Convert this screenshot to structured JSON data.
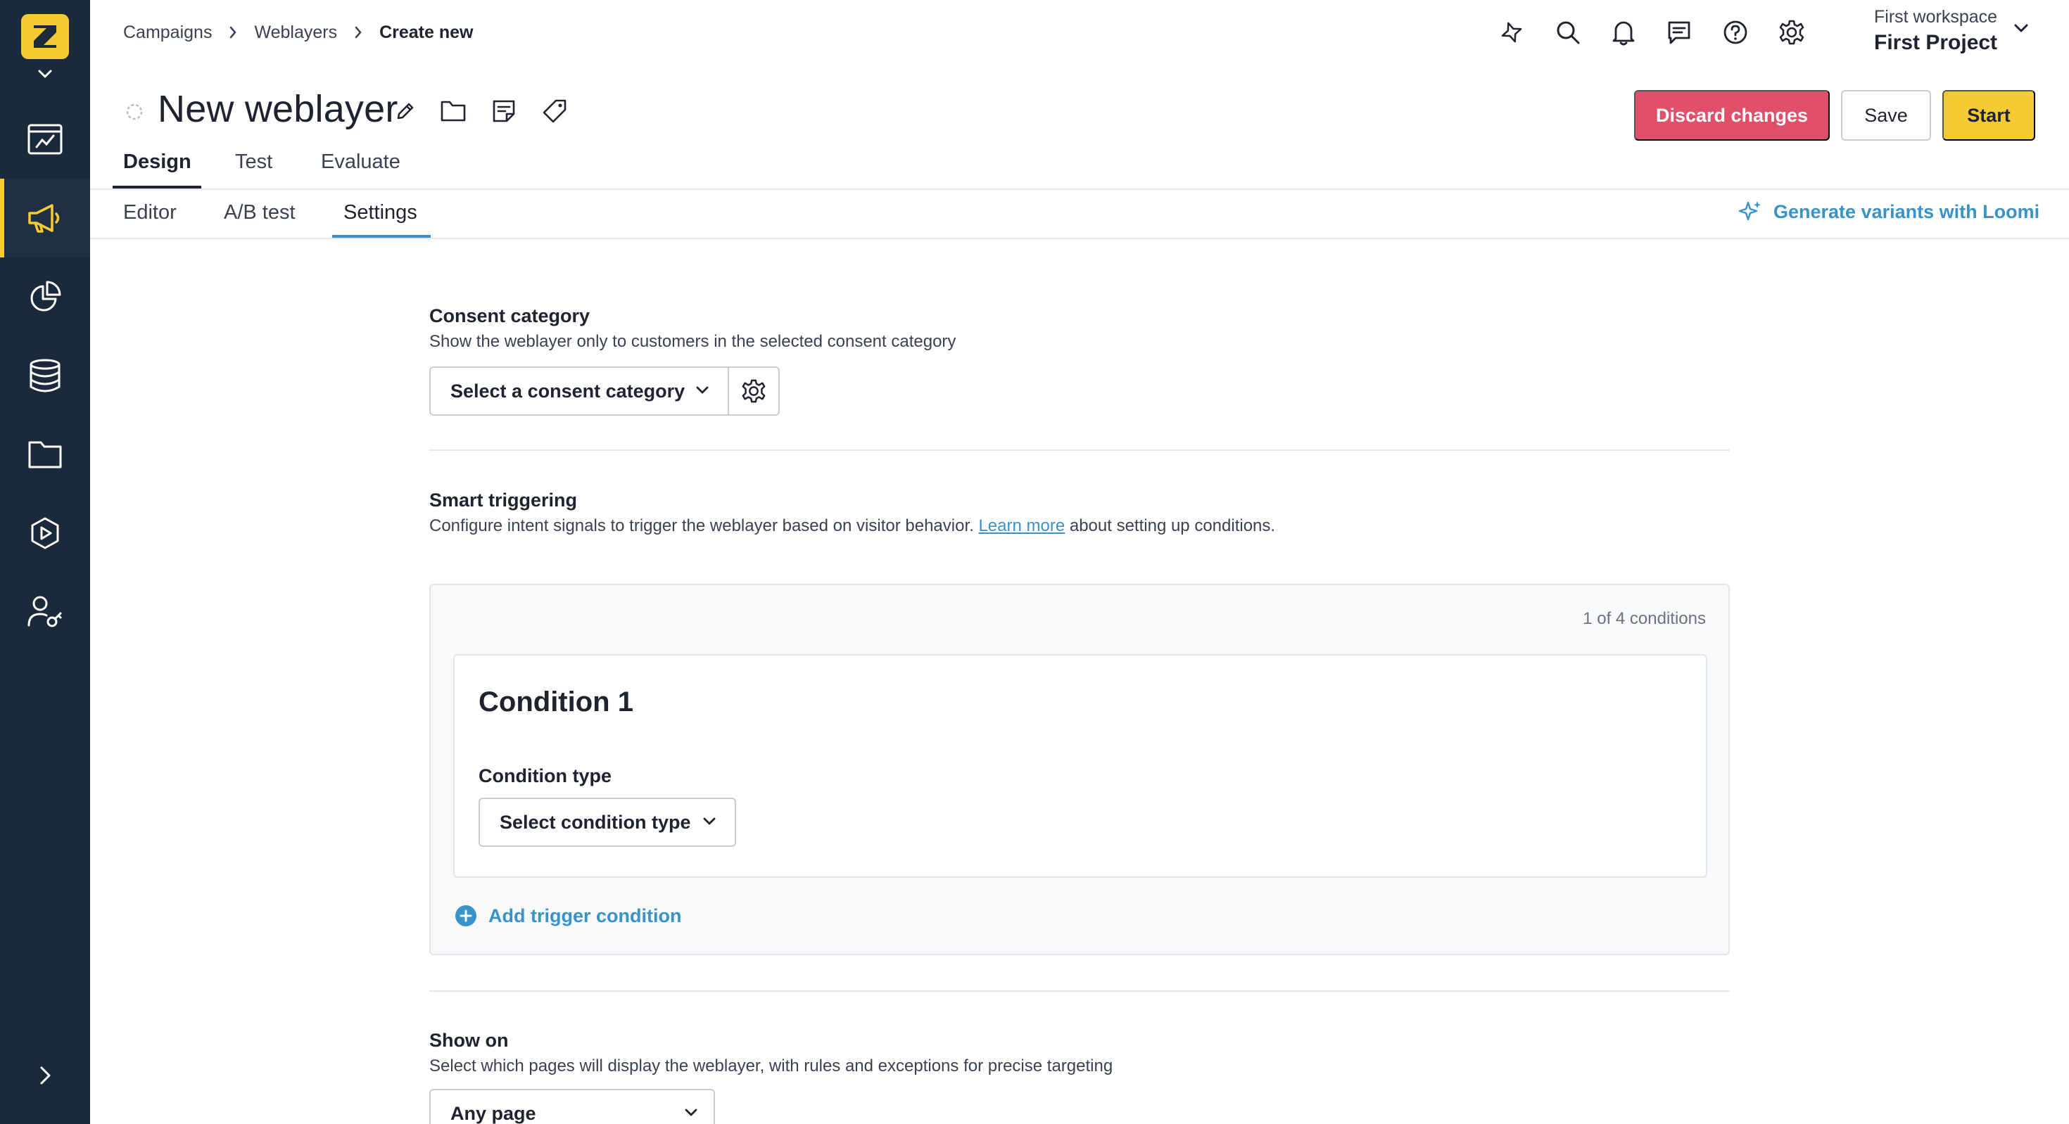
{
  "sidebar": {
    "nav": [
      {
        "name": "dashboard",
        "icon": "dashboard-chart-icon"
      },
      {
        "name": "campaigns",
        "icon": "megaphone-icon",
        "active": true
      },
      {
        "name": "analytics",
        "icon": "pie-chart-icon"
      },
      {
        "name": "data",
        "icon": "database-icon"
      },
      {
        "name": "assets",
        "icon": "folder-icon"
      },
      {
        "name": "media",
        "icon": "play-icon"
      },
      {
        "name": "access",
        "icon": "user-key-icon"
      }
    ],
    "accent_color": "#f5cb33",
    "background_color": "#1b2a3a"
  },
  "header": {
    "breadcrumb": [
      "Campaigns",
      "Weblayers",
      "Create new"
    ],
    "workspace_label": "First workspace",
    "project_name": "First Project",
    "icons": [
      "loomi-sparkle-icon",
      "search-icon",
      "bell-icon",
      "chat-icon",
      "help-icon",
      "gear-icon"
    ]
  },
  "page": {
    "title": "New weblayer",
    "title_icons": [
      "pencil-icon",
      "folder-icon",
      "note-icon",
      "tag-icon"
    ],
    "buttons": {
      "discard": "Discard changes",
      "save": "Save",
      "start": "Start"
    },
    "colors": {
      "discard": "#e0506a",
      "start": "#f5cb33",
      "link": "#3a93c8"
    }
  },
  "tabs": {
    "primary": [
      "Design",
      "Test",
      "Evaluate"
    ],
    "primary_active": "Design",
    "secondary": [
      "Editor",
      "A/B test",
      "Settings"
    ],
    "secondary_active": "Settings",
    "loomi_link": "Generate variants with Loomi"
  },
  "consent": {
    "title": "Consent category",
    "description": "Show the weblayer only to customers in the selected consent category",
    "select_value": "Select a consent category"
  },
  "smart_triggering": {
    "title": "Smart triggering",
    "description_before": "Configure intent signals to trigger the weblayer based on visitor behavior. ",
    "description_link": "Learn more",
    "description_after": " about setting up conditions.",
    "conditions_count": "1 of 4 conditions",
    "condition": {
      "title": "Condition 1",
      "type_label": "Condition type",
      "type_value": "Select condition type"
    },
    "add_trigger": "Add trigger condition"
  },
  "show_on": {
    "title": "Show on",
    "description": "Select which pages will display the weblayer, with rules and exceptions for precise targeting",
    "select_value": "Any page"
  }
}
